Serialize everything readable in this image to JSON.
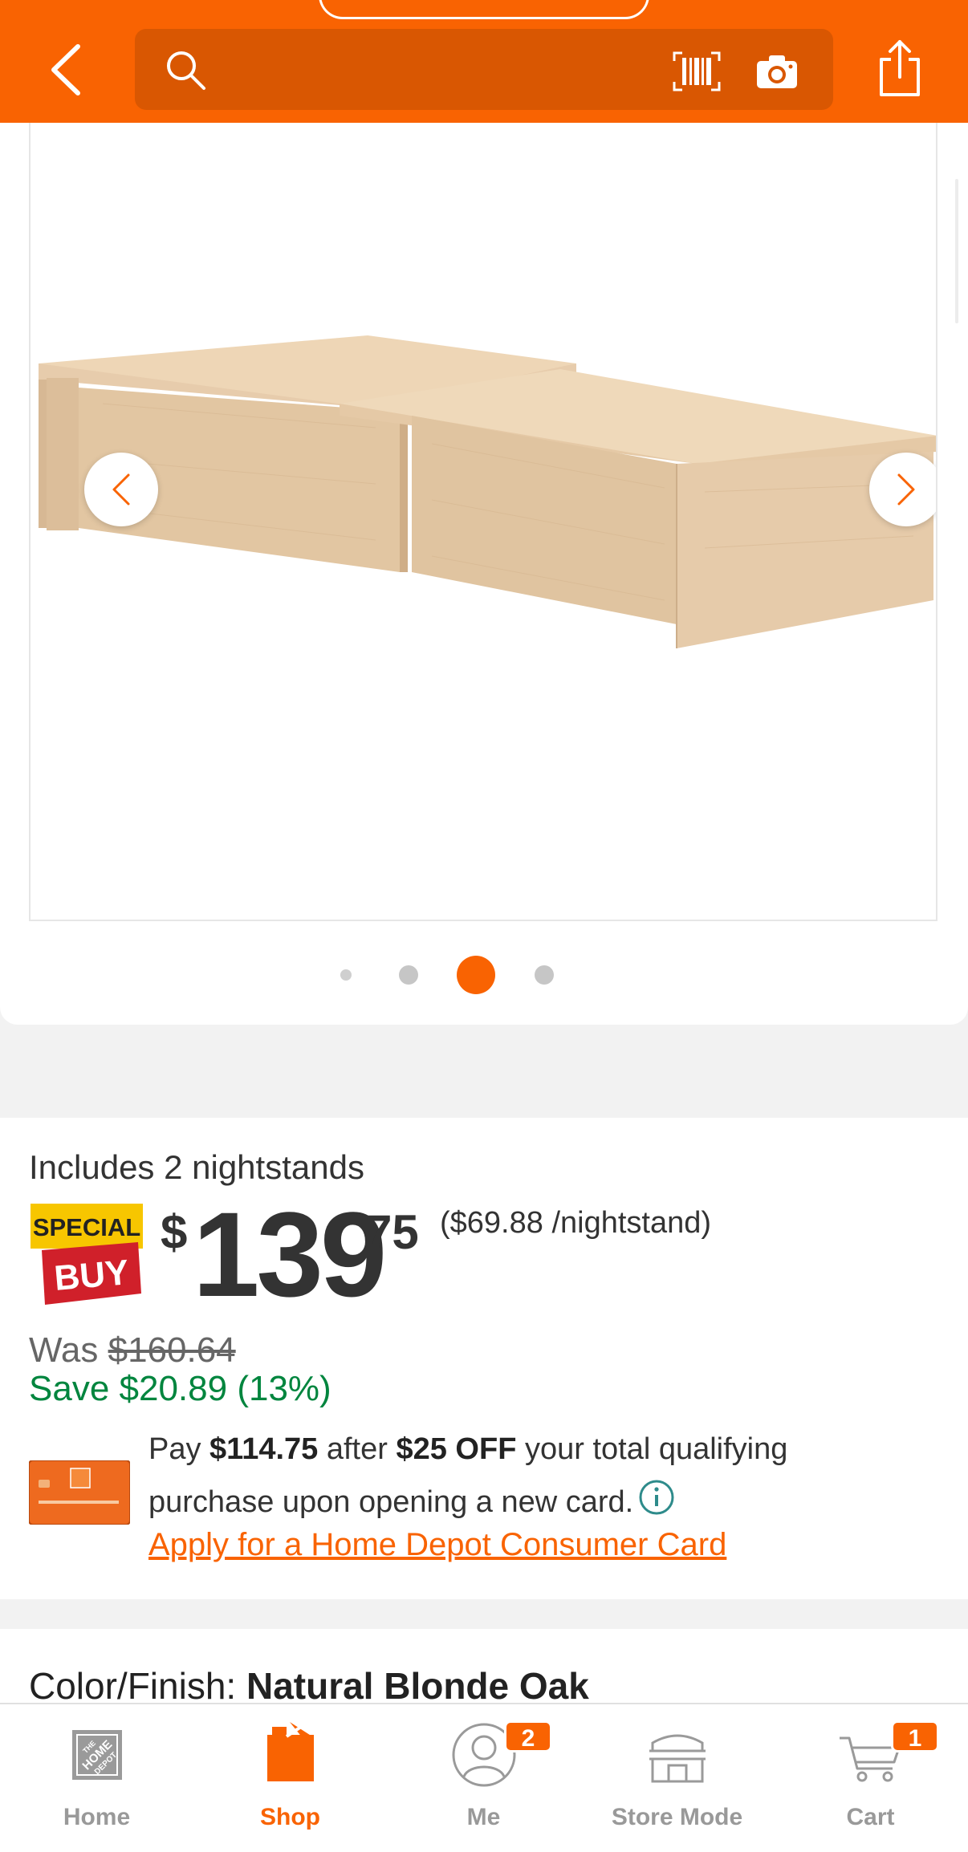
{
  "header": {
    "search_placeholder": "",
    "icons": [
      "back-arrow",
      "search",
      "barcode-scanner",
      "camera",
      "share"
    ]
  },
  "gallery": {
    "image_count": 4,
    "active_index": 2,
    "prev_icon": "chevron-left",
    "next_icon": "chevron-right"
  },
  "price": {
    "includes": "Includes 2 nightstands",
    "badge_top": "SPECIAL",
    "badge_bottom": "BUY",
    "dollar_sign": "$",
    "dollars": "139",
    "cents": "75",
    "per_unit": "($69.88 /nightstand)",
    "was_label": "Was ",
    "was_price": "$160.64",
    "save": "Save $20.89 (13%)"
  },
  "promo": {
    "pay_prefix": "Pay ",
    "pay_amount": "$114.75",
    "after": " after ",
    "discount": "$25 OFF",
    "rest": " your total qualifying purchase upon opening a new card.",
    "apply_link": "Apply for a Home Depot Consumer Card"
  },
  "color": {
    "label": "Color/Finish: ",
    "value": "Natural Blonde Oak"
  },
  "tabbar": {
    "tabs": [
      {
        "label": "Home",
        "icon": "home-depot-logo"
      },
      {
        "label": "Shop",
        "icon": "shop-bag",
        "active": true
      },
      {
        "label": "Me",
        "icon": "person",
        "badge": "2"
      },
      {
        "label": "Store Mode",
        "icon": "store"
      },
      {
        "label": "Cart",
        "icon": "cart",
        "badge": "1"
      }
    ]
  },
  "colors": {
    "brand_orange": "#f96302",
    "search_bg": "#d95702",
    "save_green": "#00853e",
    "special_red": "#d0202a",
    "special_yellow": "#f7c600"
  }
}
